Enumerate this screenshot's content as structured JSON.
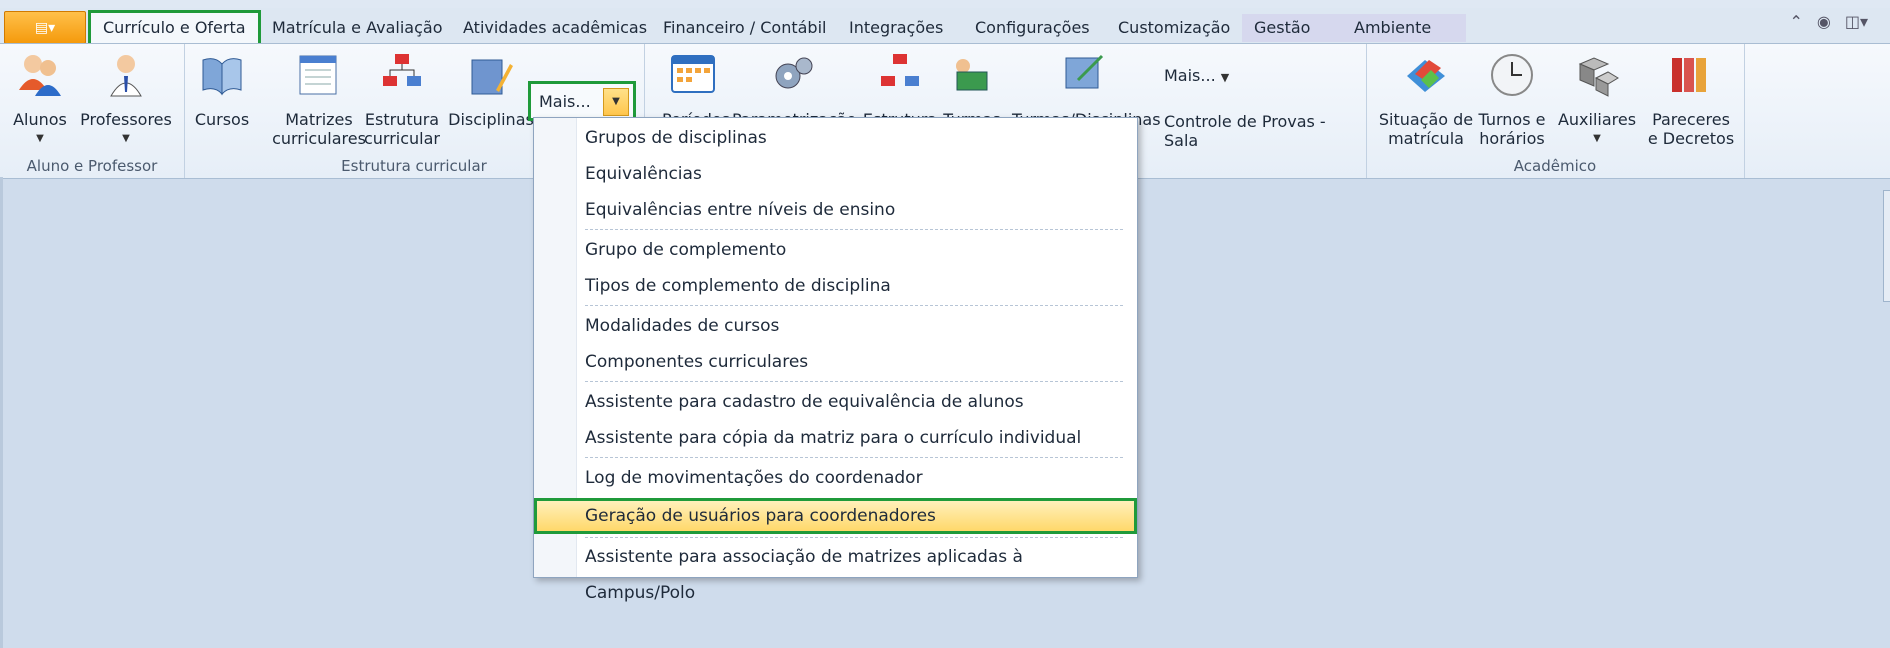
{
  "colors": {
    "highlight": "#1f9a3a",
    "ribbon_bg": "#eef4fa",
    "menu_selected": "#ffd86a",
    "workspace_bg": "#cfdcec"
  },
  "tabs": [
    {
      "label": "Currículo e Oferta"
    },
    {
      "label": "Matrícula e Avaliação"
    },
    {
      "label": "Atividades acadêmicas"
    },
    {
      "label": "Financeiro / Contábil"
    },
    {
      "label": "Integrações"
    },
    {
      "label": "Configurações"
    },
    {
      "label": "Customização"
    },
    {
      "label": "Gestão"
    },
    {
      "label": "Ambiente"
    }
  ],
  "ribbon": {
    "groups": [
      {
        "caption": "Aluno e Professor"
      },
      {
        "caption": "Estrutura curricular"
      },
      {
        "caption": ""
      },
      {
        "caption": "Acadêmico"
      }
    ],
    "buttons": {
      "alunos": "Alunos",
      "professores": "Professores",
      "cursos": "Cursos",
      "matrizes_l1": "Matrizes",
      "matrizes_l2": "curriculares",
      "estrutura_l1": "Estrutura",
      "estrutura_l2": "curricular",
      "disciplinas": "Disciplinas",
      "mais": "Mais...",
      "periodos": "Períodos",
      "parametrizacao": "Parametrização",
      "estrutura2": "Estrutura",
      "turmas": "Turmas",
      "turmas_disciplinas": "Turmas/Disciplinas",
      "mais2": "Mais...",
      "controle_provas": "Controle de Provas - Sala",
      "situacao_l1": "Situação de",
      "situacao_l2": "matrícula",
      "turnos_l1": "Turnos e",
      "turnos_l2": "horários",
      "auxiliares": "Auxiliares",
      "pareceres_l1": "Pareceres",
      "pareceres_l2": "e Decretos"
    }
  },
  "menu": {
    "items": [
      {
        "label": "Grupos de disciplinas"
      },
      {
        "label": "Equivalências"
      },
      {
        "label": "Equivalências entre níveis de ensino"
      },
      {
        "label": "Grupo de complemento"
      },
      {
        "label": "Tipos de complemento de disciplina"
      },
      {
        "label": "Modalidades de cursos"
      },
      {
        "label": "Componentes curriculares"
      },
      {
        "label": "Assistente para cadastro de equivalência de alunos"
      },
      {
        "label": "Assistente para cópia da matriz para o currículo individual"
      },
      {
        "label": "Log de movimentações do coordenador"
      },
      {
        "label": "Geração de usuários para coordenadores"
      },
      {
        "label": "Assistente para associação de matrizes aplicadas à Campus/Polo"
      }
    ]
  }
}
